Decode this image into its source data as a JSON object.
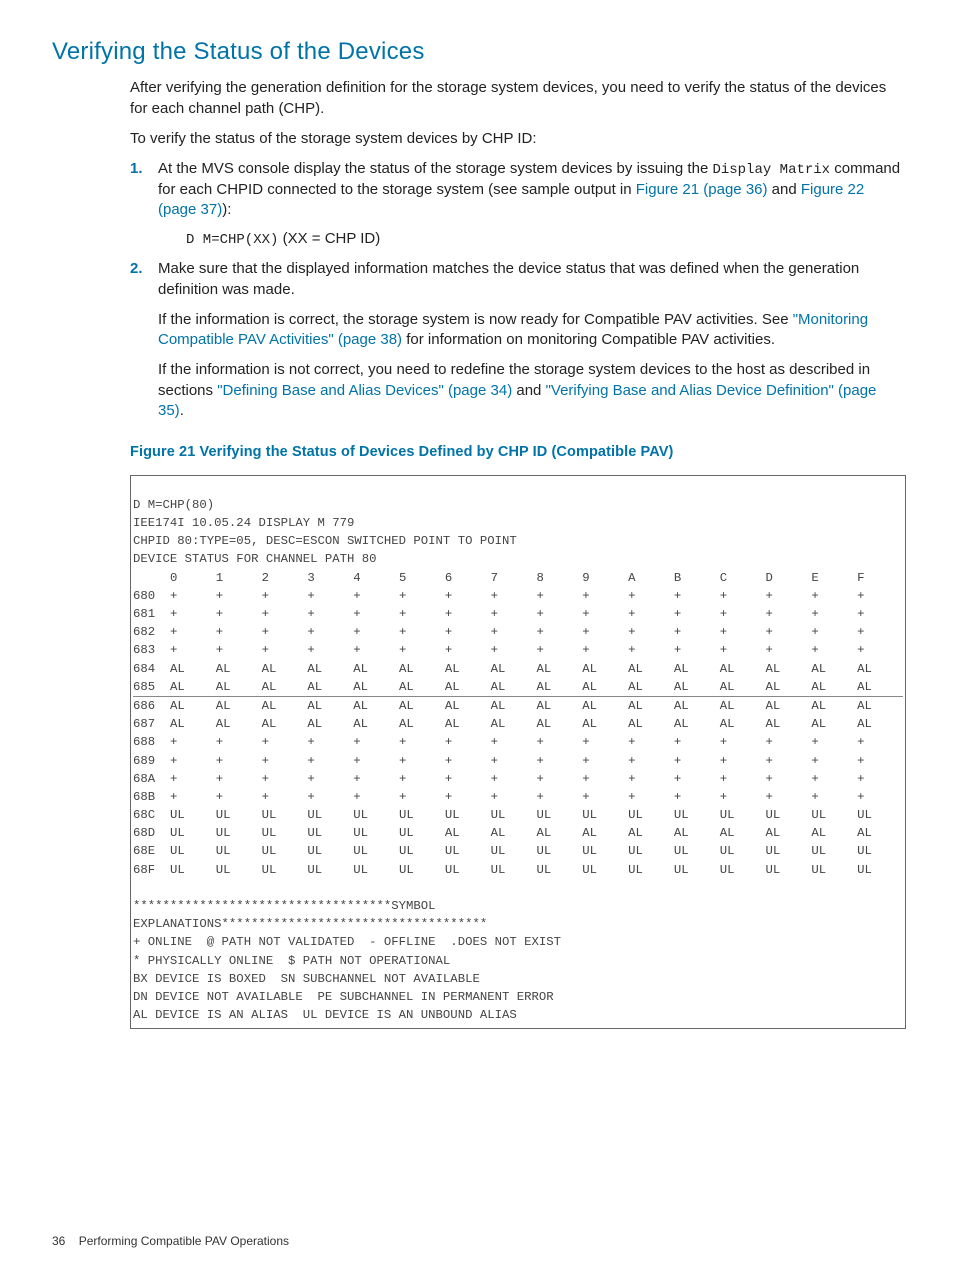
{
  "section_title": "Verifying the Status of the Devices",
  "intro_p1": "After verifying the generation definition for the storage system devices, you need to verify the status of the devices for each channel path (CHP).",
  "intro_p2": "To verify the status of the storage system devices by CHP ID:",
  "steps": {
    "s1": {
      "marker": "1.",
      "text_a": "At the MVS console display the status of the storage system devices by issuing the ",
      "code_a": "Display Matrix",
      "text_b": " command for each CHPID connected to the storage system (see sample output in ",
      "link_a": "Figure 21 (page 36)",
      "text_c": " and ",
      "link_b": "Figure 22 (page 37)",
      "text_d": "):",
      "code_line": "D M=CHP(XX)",
      "tail": " (XX = CHP ID)"
    },
    "s2": {
      "marker": "2.",
      "text_a": "Make sure that the displayed information matches the device status that was defined when the generation definition was made.",
      "p2_a": "If the information is correct, the storage system is now ready for Compatible PAV activities. See ",
      "p2_link": "\"Monitoring Compatible PAV Activities\" (page 38)",
      "p2_b": " for information on monitoring Compatible PAV activities.",
      "p3_a": "If the information is not correct, you need to redefine the storage system devices to the host as described in sections ",
      "p3_link1": "\"Defining Base and Alias Devices\" (page 34)",
      "p3_mid": " and ",
      "p3_link2": "\"Verifying Base and Alias Device Definition\" (page 35)",
      "p3_end": "."
    }
  },
  "figure_caption": "Figure 21 Verifying the Status of Devices Defined by CHP ID (Compatible PAV)",
  "fig": {
    "l1": "D M=CHP(80)",
    "l2": "IEE174I 10.05.24 DISPLAY M 779",
    "l3": "CHPID 80:TYPE=05, DESC=ESCON SWITCHED POINT TO POINT",
    "l4": "DEVICE STATUS FOR CHANNEL PATH 80",
    "headers": [
      "",
      "0",
      "1",
      "2",
      "3",
      "4",
      "5",
      "6",
      "7",
      "8",
      "9",
      "A",
      "B",
      "C",
      "D",
      "E",
      "F"
    ],
    "rows_a": [
      {
        "label": "680",
        "cells": [
          "+",
          "+",
          "+",
          "+",
          "+",
          "+",
          "+",
          "+",
          "+",
          "+",
          "+",
          "+",
          "+",
          "+",
          "+",
          "+"
        ]
      },
      {
        "label": "681",
        "cells": [
          "+",
          "+",
          "+",
          "+",
          "+",
          "+",
          "+",
          "+",
          "+",
          "+",
          "+",
          "+",
          "+",
          "+",
          "+",
          "+"
        ]
      },
      {
        "label": "682",
        "cells": [
          "+",
          "+",
          "+",
          "+",
          "+",
          "+",
          "+",
          "+",
          "+",
          "+",
          "+",
          "+",
          "+",
          "+",
          "+",
          "+"
        ]
      },
      {
        "label": "683",
        "cells": [
          "+",
          "+",
          "+",
          "+",
          "+",
          "+",
          "+",
          "+",
          "+",
          "+",
          "+",
          "+",
          "+",
          "+",
          "+",
          "+"
        ]
      },
      {
        "label": "684",
        "cells": [
          "AL",
          "AL",
          "AL",
          "AL",
          "AL",
          "AL",
          "AL",
          "AL",
          "AL",
          "AL",
          "AL",
          "AL",
          "AL",
          "AL",
          "AL",
          "AL"
        ]
      },
      {
        "label": "685",
        "cells": [
          "AL",
          "AL",
          "AL",
          "AL",
          "AL",
          "AL",
          "AL",
          "AL",
          "AL",
          "AL",
          "AL",
          "AL",
          "AL",
          "AL",
          "AL",
          "AL"
        ]
      }
    ],
    "rows_b": [
      {
        "label": "686",
        "cells": [
          "AL",
          "AL",
          "AL",
          "AL",
          "AL",
          "AL",
          "AL",
          "AL",
          "AL",
          "AL",
          "AL",
          "AL",
          "AL",
          "AL",
          "AL",
          "AL"
        ]
      },
      {
        "label": "687",
        "cells": [
          "AL",
          "AL",
          "AL",
          "AL",
          "AL",
          "AL",
          "AL",
          "AL",
          "AL",
          "AL",
          "AL",
          "AL",
          "AL",
          "AL",
          "AL",
          "AL"
        ]
      },
      {
        "label": "688",
        "cells": [
          "+",
          "+",
          "+",
          "+",
          "+",
          "+",
          "+",
          "+",
          "+",
          "+",
          "+",
          "+",
          "+",
          "+",
          "+",
          "+"
        ]
      },
      {
        "label": "689",
        "cells": [
          "+",
          "+",
          "+",
          "+",
          "+",
          "+",
          "+",
          "+",
          "+",
          "+",
          "+",
          "+",
          "+",
          "+",
          "+",
          "+"
        ]
      },
      {
        "label": "68A",
        "cells": [
          "+",
          "+",
          "+",
          "+",
          "+",
          "+",
          "+",
          "+",
          "+",
          "+",
          "+",
          "+",
          "+",
          "+",
          "+",
          "+"
        ]
      },
      {
        "label": "68B",
        "cells": [
          "+",
          "+",
          "+",
          "+",
          "+",
          "+",
          "+",
          "+",
          "+",
          "+",
          "+",
          "+",
          "+",
          "+",
          "+",
          "+"
        ]
      },
      {
        "label": "68C",
        "cells": [
          "UL",
          "UL",
          "UL",
          "UL",
          "UL",
          "UL",
          "UL",
          "UL",
          "UL",
          "UL",
          "UL",
          "UL",
          "UL",
          "UL",
          "UL",
          "UL"
        ]
      },
      {
        "label": "68D",
        "cells": [
          "UL",
          "UL",
          "UL",
          "UL",
          "UL",
          "UL",
          "AL",
          "AL",
          "AL",
          "AL",
          "AL",
          "AL",
          "AL",
          "AL",
          "AL",
          "AL"
        ]
      },
      {
        "label": "68E",
        "cells": [
          "UL",
          "UL",
          "UL",
          "UL",
          "UL",
          "UL",
          "UL",
          "UL",
          "UL",
          "UL",
          "UL",
          "UL",
          "UL",
          "UL",
          "UL",
          "UL"
        ]
      },
      {
        "label": "68F",
        "cells": [
          "UL",
          "UL",
          "UL",
          "UL",
          "UL",
          "UL",
          "UL",
          "UL",
          "UL",
          "UL",
          "UL",
          "UL",
          "UL",
          "UL",
          "UL",
          "UL"
        ]
      }
    ],
    "trailer": [
      "***********************************SYMBOL",
      "EXPLANATIONS************************************",
      "+ ONLINE  @ PATH NOT VALIDATED  - OFFLINE  .DOES NOT EXIST",
      "* PHYSICALLY ONLINE  $ PATH NOT OPERATIONAL",
      "BX DEVICE IS BOXED  SN SUBCHANNEL NOT AVAILABLE",
      "DN DEVICE NOT AVAILABLE  PE SUBCHANNEL IN PERMANENT ERROR",
      "AL DEVICE IS AN ALIAS  UL DEVICE IS AN UNBOUND ALIAS"
    ]
  },
  "footer": {
    "page": "36",
    "label": "Performing Compatible PAV Operations"
  }
}
